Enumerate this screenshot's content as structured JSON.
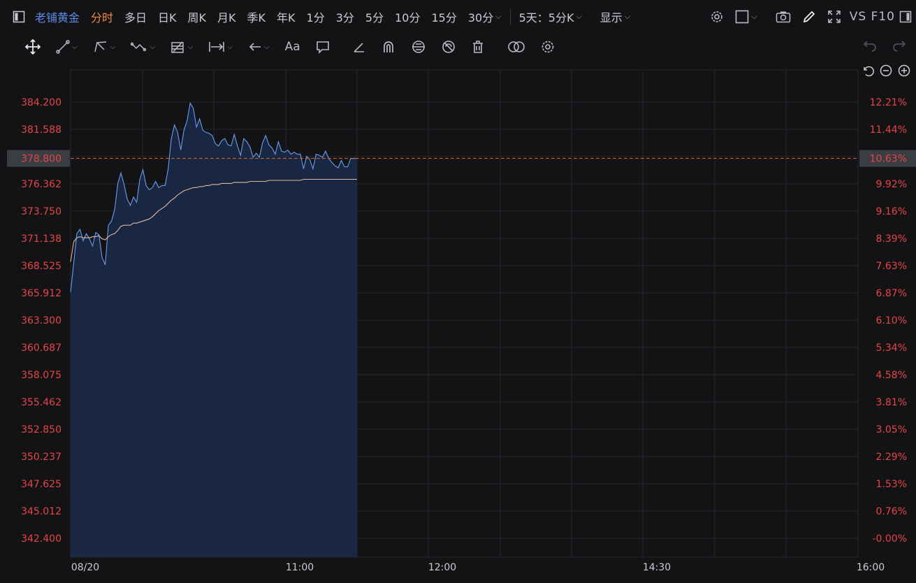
{
  "toolbar": {
    "title": "老铺黄金",
    "tabs": [
      "分时",
      "多日",
      "日K",
      "周K",
      "月K",
      "季K",
      "年K",
      "1分",
      "3分",
      "5分",
      "10分",
      "15分",
      "30分"
    ],
    "active_tab": "分时",
    "period_select": "5天：5分K",
    "display_label": "显示",
    "vs_f10": "VS F10"
  },
  "drawing_tools": {
    "text_tool": "Aa"
  },
  "colors": {
    "background": "#131315",
    "grid": "#26272b",
    "price_line": "#6b9cf0",
    "area_fill": "#1b2b4b",
    "avg_line": "#e0b7a2",
    "axis_label": "#e64545",
    "ref_line": "#d4693f"
  },
  "chart_data": {
    "type": "area",
    "title": "",
    "xlabel": "",
    "ylabel": "",
    "ylim": [
      342.4,
      384.2
    ],
    "x_ticks": [
      "08/20",
      "11:00",
      "12:00",
      "14:30",
      "16:00"
    ],
    "y_ticks_left": [
      "384.200",
      "381.588",
      "378.800",
      "376.362",
      "373.750",
      "371.138",
      "368.525",
      "365.912",
      "363.300",
      "360.687",
      "358.075",
      "355.462",
      "352.850",
      "350.237",
      "347.625",
      "345.012",
      "342.400"
    ],
    "y_ticks_right": [
      "12.21%",
      "11.44%",
      "10.63%",
      "9.92%",
      "9.16%",
      "8.39%",
      "7.63%",
      "6.87%",
      "6.10%",
      "5.34%",
      "4.58%",
      "3.81%",
      "3.05%",
      "2.29%",
      "1.53%",
      "0.76%",
      "-0.00%"
    ],
    "reference": {
      "value": 378.8,
      "left_label": "378.800",
      "right_label": "10.63%"
    },
    "series": [
      {
        "values": [
          366.0,
          368.8,
          371.6,
          372.0,
          370.9,
          371.6,
          371.1,
          370.4,
          371.7,
          371.5,
          369.3,
          368.6,
          372.4,
          372.8,
          373.9,
          376.4,
          377.4,
          376.3,
          374.9,
          374.3,
          375.1,
          374.6,
          376.8,
          377.7,
          376.2,
          375.8,
          376.0,
          376.6,
          376.0,
          376.2,
          376.2,
          377.8,
          380.7,
          382.0,
          381.3,
          379.6,
          381.5,
          382.4,
          384.1,
          383.6,
          381.8,
          382.6,
          381.5,
          381.3,
          381.2,
          381.0,
          380.2,
          380.0,
          380.5,
          380.7,
          380.1,
          380.0,
          381.1,
          380.0,
          379.1,
          380.7,
          380.4,
          379.9,
          378.9,
          379.3,
          378.9,
          380.3,
          381.0,
          380.1,
          379.8,
          379.2,
          380.4,
          379.5,
          379.4,
          379.6,
          379.2,
          379.4,
          379.2,
          379.2,
          377.8,
          379.0,
          378.7,
          377.8,
          379.2,
          379.1,
          378.9,
          379.5,
          378.8,
          378.4,
          378.1,
          377.9,
          378.6,
          378.0,
          378.0,
          378.8,
          378.8,
          378.8
        ]
      },
      {
        "values": [
          368.9,
          370.8,
          371.2,
          371.3,
          371.2,
          371.2,
          371.2,
          371.3,
          371.3,
          371.4,
          371.1,
          371.0,
          371.3,
          371.5,
          371.6,
          371.9,
          372.3,
          372.4,
          372.4,
          372.4,
          372.6,
          372.6,
          372.7,
          372.8,
          372.9,
          373.0,
          373.2,
          373.5,
          373.8,
          374.0,
          374.2,
          374.5,
          374.8,
          375.0,
          375.3,
          375.5,
          375.7,
          375.8,
          375.9,
          376.0,
          376.0,
          376.1,
          376.1,
          376.2,
          376.2,
          376.3,
          376.3,
          376.3,
          376.4,
          376.4,
          376.4,
          376.4,
          376.5,
          376.5,
          376.5,
          376.5,
          376.5,
          376.6,
          376.6,
          376.6,
          376.6,
          376.6,
          376.6,
          376.7,
          376.7,
          376.7,
          376.7,
          376.7,
          376.7,
          376.7,
          376.7,
          376.7,
          376.7,
          376.7,
          376.8,
          376.8,
          376.8,
          376.8,
          376.8,
          376.8,
          376.8,
          376.8,
          376.8,
          376.8,
          376.8,
          376.8,
          376.8,
          376.8,
          376.8,
          376.8,
          376.8,
          376.8
        ]
      }
    ],
    "grid": true
  }
}
